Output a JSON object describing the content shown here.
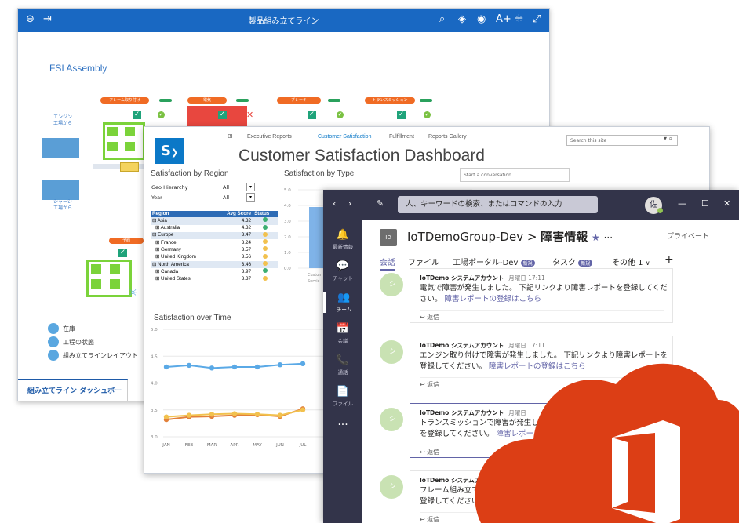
{
  "powerbi": {
    "window_title": "製品組み立てライン",
    "page_title": "FSI Assembly",
    "stations": [
      "フレーム取り付け",
      "電気",
      "ブレーキ",
      "トランスミッション",
      "予約"
    ],
    "engine_label": "エンジン\n工場から",
    "chassis_label": "シャーシ\n工場から",
    "legend": [
      "在庫",
      "工程の状態",
      "組み立てラインレイアウト"
    ],
    "bottom_tab": "組み立てライン ダッシュボード",
    "accent": "#1968c2"
  },
  "sharepoint": {
    "nav": [
      "BI",
      "Executive Reports",
      "Customer Satisfaction",
      "Fulfillment",
      "Reports Gallery"
    ],
    "search_placeholder": "Search this site",
    "title": "Customer Satisfaction Dashboard",
    "conversation_placeholder": "Start a conversation",
    "region_section": "Satisfaction by Region",
    "type_section": "Satisfaction by Type",
    "time_section": "Satisfaction over Time",
    "filters": [
      {
        "label": "Geo Hierarchy",
        "value": "All"
      },
      {
        "label": "Year",
        "value": "All"
      }
    ],
    "table_headers": [
      "Region",
      "Avg Score",
      "Status"
    ],
    "table_rows": [
      {
        "name": "⊟ Asia",
        "score": "4.32",
        "status": "#3cae72",
        "group": true
      },
      {
        "name": "⊞ Australia",
        "score": "4.32",
        "status": "#3cae72",
        "group": false
      },
      {
        "name": "⊟ Europe",
        "score": "3.47",
        "status": "#f2c14e",
        "group": true
      },
      {
        "name": "⊞ France",
        "score": "3.24",
        "status": "#f2c14e",
        "group": false
      },
      {
        "name": "⊞ Germany",
        "score": "3.57",
        "status": "#f2c14e",
        "group": false
      },
      {
        "name": "⊞ United Kingdom",
        "score": "3.56",
        "status": "#f2c14e",
        "group": false
      },
      {
        "name": "⊟ North America",
        "score": "3.46",
        "status": "#f2c14e",
        "group": true
      },
      {
        "name": "⊞ Canada",
        "score": "3.97",
        "status": "#3cae72",
        "group": false
      },
      {
        "name": "⊞ United States",
        "score": "3.37",
        "status": "#f2c14e",
        "group": false
      }
    ],
    "type_chart": {
      "yticks": [
        "5.0",
        "4.0",
        "3.0",
        "2.0",
        "1.0",
        "0.0"
      ],
      "xlabel_fragment": [
        "Custom",
        "Servic"
      ]
    },
    "time_chart": {
      "type": "line",
      "x": [
        "JAN",
        "FEB",
        "MAR",
        "APR",
        "MAY",
        "JUN",
        "JUL"
      ],
      "yticks": [
        "5.0",
        "4.5",
        "4.0",
        "3.5",
        "3.0"
      ],
      "ylim": [
        3.0,
        5.0
      ],
      "series": [
        {
          "color": "#5aa9e6",
          "values": [
            4.3,
            4.33,
            4.28,
            4.3,
            4.3,
            4.34,
            4.36
          ]
        },
        {
          "color": "#e2803a",
          "values": [
            3.32,
            3.37,
            3.38,
            3.4,
            3.41,
            3.38,
            3.52
          ]
        },
        {
          "color": "#f2c14e",
          "values": [
            3.37,
            3.4,
            3.42,
            3.43,
            3.42,
            3.4,
            3.5
          ]
        }
      ]
    }
  },
  "teams": {
    "search_placeholder": "人、キーワードの検索、またはコマンドの入力",
    "user_avatar": "佐",
    "rail": [
      {
        "icon": "bell-icon",
        "glyph": "🔔",
        "label": "最新情報"
      },
      {
        "icon": "chat-icon",
        "glyph": "💬",
        "label": "チャット"
      },
      {
        "icon": "teams-icon",
        "glyph": "👥",
        "label": "チーム"
      },
      {
        "icon": "calendar-icon",
        "glyph": "📅",
        "label": "会議"
      },
      {
        "icon": "call-icon",
        "glyph": "📞",
        "label": "通話"
      },
      {
        "icon": "file-icon",
        "glyph": "📄",
        "label": "ファイル"
      }
    ],
    "more_glyph": "···",
    "team_initials": "ID",
    "team_name": "IoTDemoGroup-Dev",
    "separator": ">",
    "channel": "障害情報",
    "private_label": "プライベート",
    "ellipsis": "···",
    "tabs": [
      "会話",
      "ファイル",
      "工場ポータル-Dev",
      "タスク",
      "その他 1"
    ],
    "new_badge": "新規",
    "add_tab": "+",
    "messages": [
      {
        "author": "IoTDemo システムアカウント",
        "time": "月曜日 17:11",
        "text": "電気で障害が発生しました。 下記リンクより障害レポートを登録してください。",
        "link": "障害レポートの登録はこちら",
        "reply": "↩ 返信",
        "avatar": "Iシ"
      },
      {
        "author": "IoTDemo システムアカウント",
        "time": "月曜日 17:11",
        "text": "エンジン取り付けで障害が発生しました。 下記リンクより障害レポートを登録してください。",
        "link": "障害レポートの登録はこちら",
        "reply": "↩ 返信",
        "avatar": "Iシ"
      },
      {
        "author": "IoTDemo システムアカウント",
        "time": "月曜日",
        "text": "トランスミッションで障害が発生しました。下記リンクより障害レポートを登録してください。",
        "link": "障害レポートの登録はこちら",
        "reply": "↩ 返信",
        "avatar": "Iシ"
      },
      {
        "author": "IoTDemo システムアカウント",
        "time": "",
        "text": "フレーム組み立てで障害が発生しました。下記リンクより障害レポートを登録してください。",
        "link": "",
        "reply": "↩ 返信",
        "avatar": "Iシ"
      }
    ],
    "accent": "#6264a7"
  },
  "office_logo_color": "#dc3e15"
}
